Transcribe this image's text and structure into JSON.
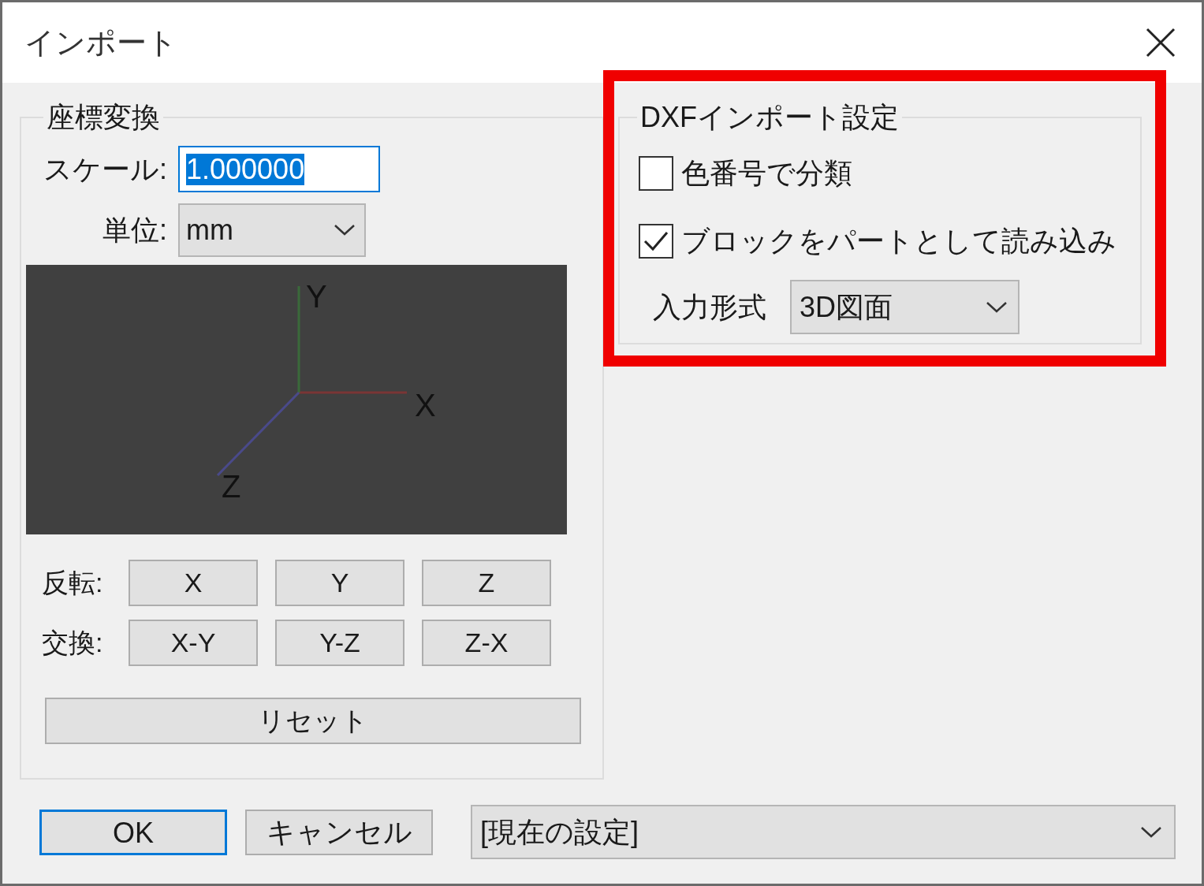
{
  "window": {
    "title": "インポート"
  },
  "coordinate_transform": {
    "title": "座標変換",
    "scale": {
      "label": "スケール:",
      "value": "1.000000"
    },
    "unit": {
      "label": "単位:",
      "value": "mm"
    },
    "preview": {
      "axis_labels": [
        "X",
        "Y",
        "Z"
      ]
    },
    "flip": {
      "label": "反転:",
      "buttons": [
        "X",
        "Y",
        "Z"
      ]
    },
    "swap": {
      "label": "交換:",
      "buttons": [
        "X-Y",
        "Y-Z",
        "Z-X"
      ]
    },
    "reset_button": "リセット"
  },
  "dxf_settings": {
    "title": "DXFインポート設定",
    "options": [
      {
        "label": "色番号で分類",
        "checked": false
      },
      {
        "label": "ブロックをパートとして読み込み",
        "checked": true
      }
    ],
    "input_format": {
      "label": "入力形式",
      "value": "3D図面"
    }
  },
  "buttons": [
    {
      "label": "OK",
      "default": true
    },
    {
      "label": "キャンセル",
      "default": false
    }
  ],
  "preset": {
    "value": "[現在の設定]"
  }
}
